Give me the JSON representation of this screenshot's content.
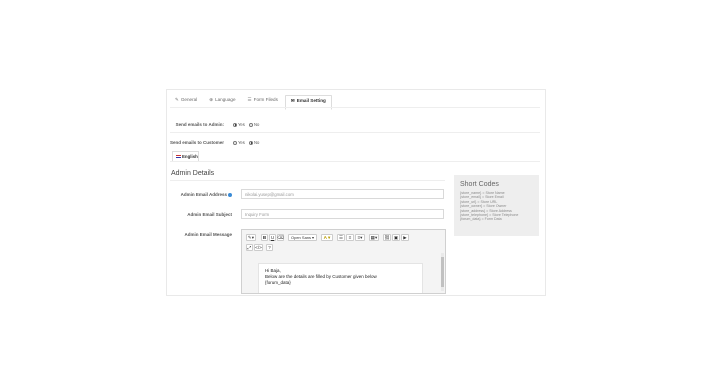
{
  "tabs": [
    {
      "label": "General",
      "icon": "pencil-icon"
    },
    {
      "label": "Language",
      "icon": "globe-icon"
    },
    {
      "label": "Form Fileds",
      "icon": "list-icon"
    },
    {
      "label": "Email Setting",
      "icon": "envelope-icon"
    }
  ],
  "send_admin": {
    "label": "Send emails to Admin:",
    "yes": "Yes",
    "no": "No",
    "selected": "Yes"
  },
  "send_customer": {
    "label": "Send emails to Customer",
    "yes": "Yes",
    "no": "No",
    "selected": "No"
  },
  "lang_tab": {
    "label": "English"
  },
  "admin_details": {
    "title": "Admin Details",
    "email_label": "Admin Email Address",
    "email_value": "nikolai.yusep@gmail.com",
    "subject_label": "Admin Email Subject",
    "subject_value": "Inquiry Form",
    "message_label": "Admin Email Message"
  },
  "editor": {
    "font_label": "Open Sans",
    "body_lines": [
      "Hi Baja,",
      "Below are the details are filled by Customer given below",
      "{forum_data}"
    ]
  },
  "short_codes": {
    "title": "Short Codes",
    "items": [
      "{store_name} = Store Name",
      "{store_email} = Store Email",
      "{store_url} = Store URL",
      "{store_owner} = Store Owner",
      "{store_address} = Store Address",
      "{store_telephone} = Store Telephone",
      "{forum_data} = Form Data"
    ]
  }
}
